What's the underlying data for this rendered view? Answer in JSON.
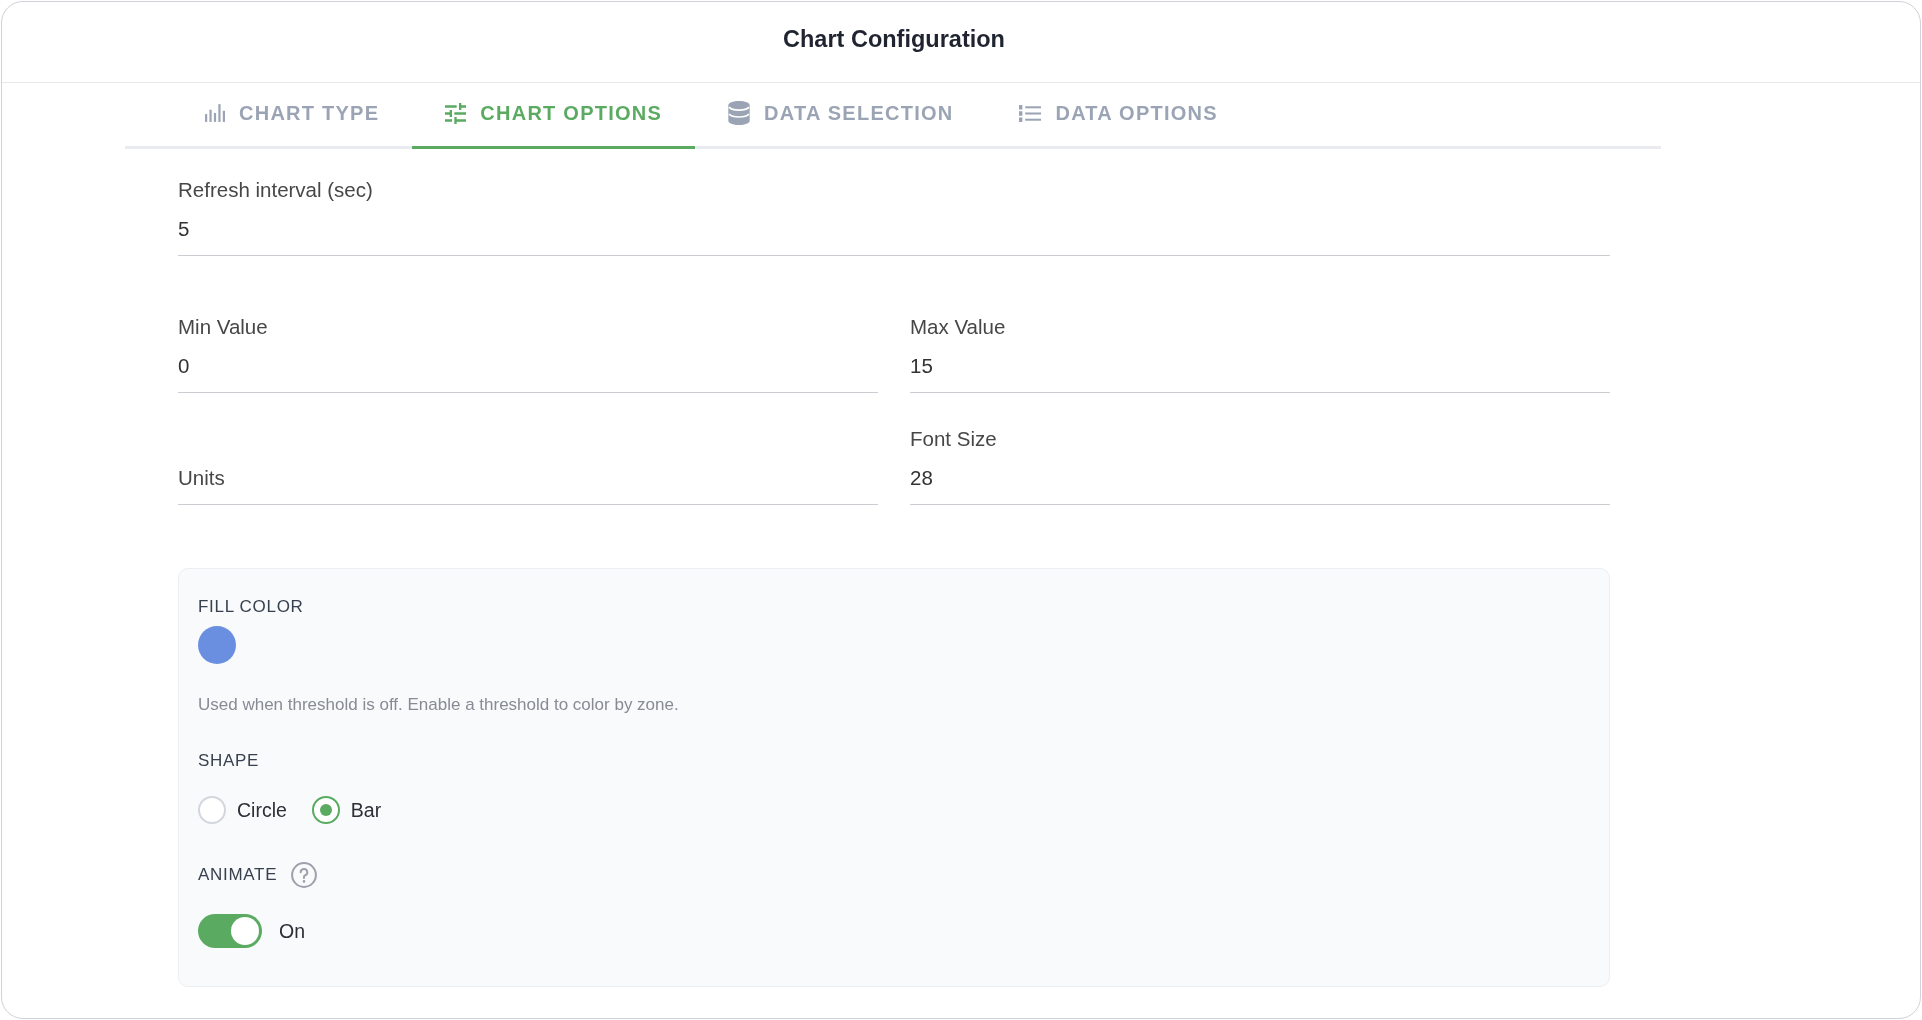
{
  "window": {
    "title": "Chart Configuration"
  },
  "tabs": [
    {
      "label": "CHART TYPE",
      "selected": false
    },
    {
      "label": "CHART OPTIONS",
      "selected": true
    },
    {
      "label": "DATA SELECTION",
      "selected": false
    },
    {
      "label": "DATA OPTIONS",
      "selected": false
    }
  ],
  "form": {
    "rows": [
      {
        "fields": [
          {
            "label": "Refresh interval (sec)",
            "value": "5"
          }
        ]
      },
      {
        "fields": [
          {
            "label": "Min Value",
            "value": "0"
          },
          {
            "label": "Max Value",
            "value": "15"
          }
        ]
      },
      {
        "fields": [
          {
            "label": "Units"
          },
          {
            "label": "Font Size",
            "value": "28"
          }
        ]
      }
    ]
  },
  "fill_panel": {
    "fill_color": {
      "label": "FILL COLOR",
      "color": "#6a8fe0"
    },
    "hint": "Used when threshold is off. Enable a threshold to color by zone.",
    "shape": {
      "label": "SHAPE",
      "options": [
        {
          "label": "Circle",
          "selected": false
        },
        {
          "label": "Bar",
          "selected": true
        }
      ]
    },
    "animate": {
      "label": "ANIMATE",
      "on": true,
      "status": "On"
    }
  }
}
